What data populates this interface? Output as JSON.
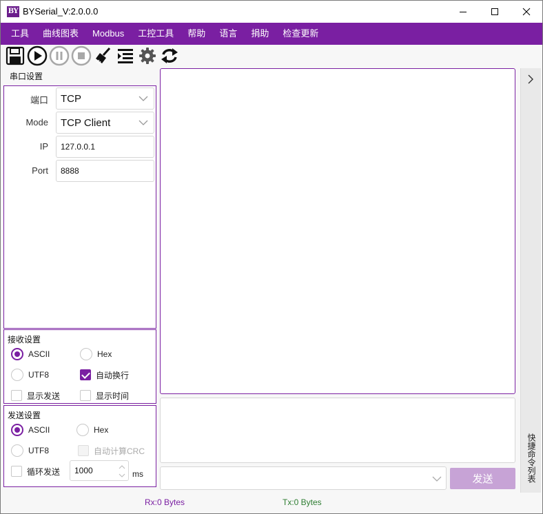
{
  "window": {
    "title": "BYSerial_V:2.0.0.0",
    "logo_text": "BY"
  },
  "menu": [
    "工具",
    "曲线图表",
    "Modbus",
    "工控工具",
    "帮助",
    "语言",
    "捐助",
    "检查更新"
  ],
  "toolbar": [
    "save-icon",
    "play-icon",
    "pause-icon",
    "stop-icon",
    "clear-broom-icon",
    "list-indent-icon",
    "gear-icon",
    "refresh-icon"
  ],
  "port_settings": {
    "title": "串口设置",
    "port_label": "端口",
    "port_value": "TCP",
    "mode_label": "Mode",
    "mode_value": "TCP Client",
    "ip_label": "IP",
    "ip_value": "127.0.0.1",
    "port_num_label": "Port",
    "port_num_value": "8888"
  },
  "receive_settings": {
    "title": "接收设置",
    "ascii": "ASCII",
    "hex": "Hex",
    "utf8": "UTF8",
    "auto_newline": "自动换行",
    "show_send": "显示发送",
    "show_time": "显示时间"
  },
  "send_settings": {
    "title": "发送设置",
    "ascii": "ASCII",
    "hex": "Hex",
    "utf8": "UTF8",
    "auto_crc": "自动计算CRC",
    "loop_send": "循环发送",
    "interval_value": "1000",
    "interval_unit": "ms"
  },
  "send_button": "发送",
  "side_panel_label": "快捷命令列表",
  "status": {
    "rx": "Rx:0 Bytes",
    "tx": "Tx:0 Bytes"
  },
  "colors": {
    "accent": "#7a1fa2",
    "send_button_disabled": "#c7a3d6",
    "tx_text": "#2e7d32"
  }
}
